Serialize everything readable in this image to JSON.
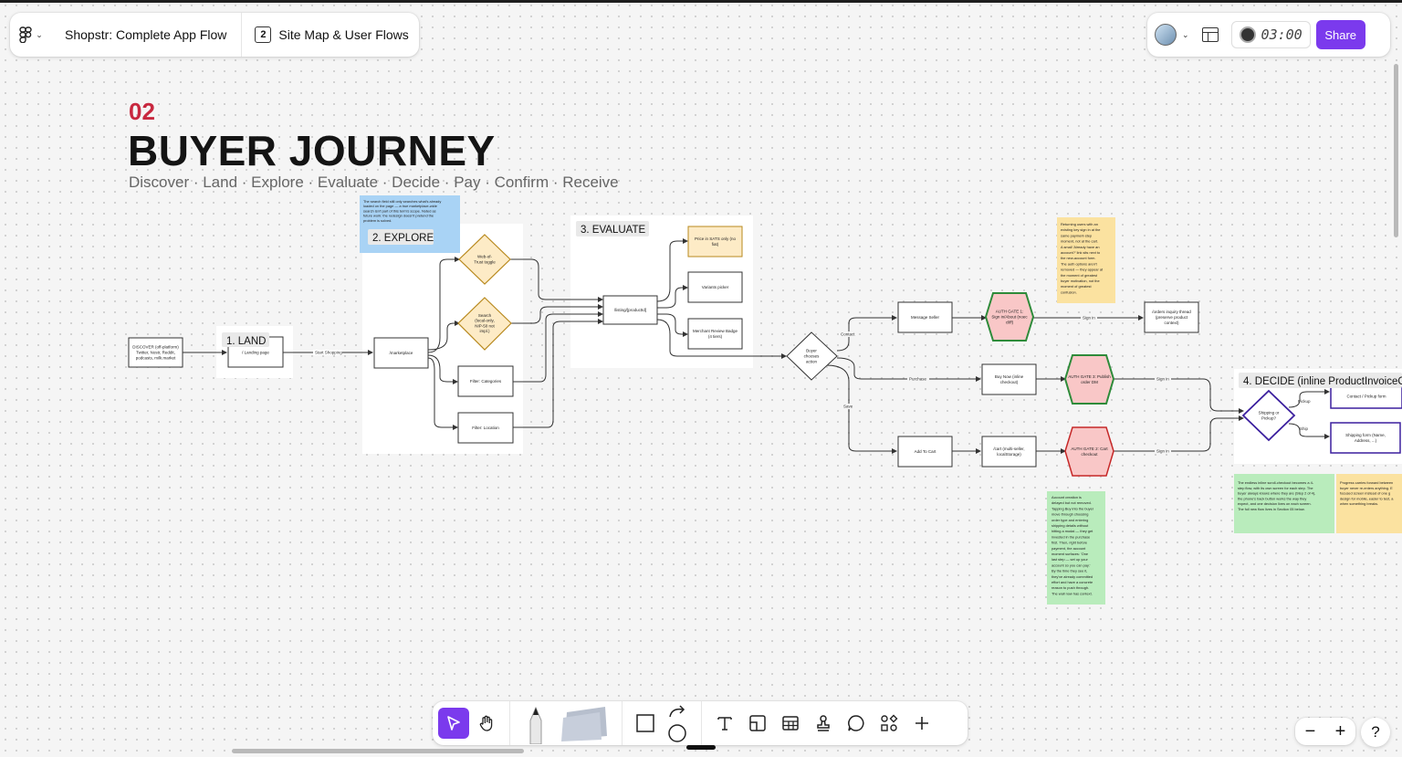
{
  "header": {
    "file_name": "Shopstr: Complete App Flow",
    "page_number": "2",
    "page_name": "Site Map & User Flows",
    "timer": "03:00",
    "share_label": "Share"
  },
  "section": {
    "number": "02",
    "title": "BUYER JOURNEY",
    "subtitle": "Discover · Land · Explore · Evaluate · Decide · Pay · Confirm · Receive"
  },
  "frames": {
    "land": "1. LAND",
    "explore": "2. EXPLORE",
    "evaluate": "3. EVALUATE",
    "decide": "4. DECIDE (inline ProductInvoiceC"
  },
  "nodes": {
    "discover": [
      "DISCOVER (off-platform)",
      "Twitter, Nostr, Reddit,",
      "podcasts, milk.market"
    ],
    "landing": [
      "/ Landing page"
    ],
    "marketplace": [
      "/marketplace"
    ],
    "wot": [
      "Web-of-",
      "Trust toggle"
    ],
    "search": [
      "Search",
      "(local-only,",
      "NIP-50 not",
      "impl.)"
    ],
    "filter_categories": [
      "Filter: Categories"
    ],
    "filter_location": [
      "Filter: Location"
    ],
    "listing": [
      "/listing/[productId]"
    ],
    "price": [
      "Price in SATS only (no",
      "fiat)"
    ],
    "variants": [
      "Variants picker"
    ],
    "merchant": [
      "Merchant Review Badge",
      "(4 tiers)"
    ],
    "buyer_action": [
      "Buyer",
      "chooses",
      "action"
    ],
    "message_seller": [
      "Message Seller"
    ],
    "buy_now": [
      "Buy Now (inline",
      "checkout)"
    ],
    "add_to_cart": [
      "Add To Cart"
    ],
    "cart": [
      "/cart (multi-seller,",
      "localStorage)"
    ],
    "auth1": [
      "AUTH GATE 1:",
      "Sign in/About (noec",
      "cliff)"
    ],
    "auth3": [
      "AUTH GATE 3: Publish",
      "order DM"
    ],
    "auth2": [
      "AUTH GATE 2: Cart",
      "checkout"
    ],
    "orders": [
      "/orders inquiry thread",
      "(preserve product",
      "context)"
    ],
    "shipping": [
      "Shipping or",
      "Pickup?"
    ],
    "contact_pickup": [
      "Contact / Pickup form"
    ],
    "shipping_form": [
      "Shipping form (Name,",
      "Address, ...)"
    ]
  },
  "edge_labels": {
    "start_shopping": "Start Shopping",
    "contact": "Contact",
    "purchase": "Purchase",
    "save": "Save",
    "sign_in": "Sign in",
    "pickup": "Pickup",
    "ship": "Ship"
  },
  "notes": {
    "explore_note": [
      "The search field still only searches what's already",
      "loaded on the page — a true marketplace-wide",
      "search isn't part of this term's scope. Noted as",
      "future work: the redesign doesn't pretend the",
      "problem is solved."
    ],
    "auth_note": [
      "Returning users with an",
      "existing key sign in at the",
      "same payment-step",
      "moment, not at the cart.",
      "A small 'Already have an",
      "account?' link sits next to",
      "the new-account form.",
      "The auth options aren't",
      "removed — they appear at",
      "the moment of greatest",
      "buyer motivation, not the",
      "moment of greatest",
      "confusion."
    ],
    "account_note": [
      "Account creation is",
      "delayed but not removed.",
      "Tapping Buy into the buyer",
      "move through choosing",
      "order type and entering",
      "shipping details without",
      "hitting a modal — they get",
      "invested in the purchase",
      "first. Then, right before",
      "payment, the account",
      "moment surfaces: 'One",
      "last step — set up your",
      "account so you can pay.'",
      "By the time they see it,",
      "they've already committed",
      "effort and have a concrete",
      "reason to push through.",
      "The wall now has context."
    ],
    "checkout_note": [
      "The endless inline scroll-checkout becomes a 4-",
      "step flow, with its own screen for each step. The",
      "buyer always knows where they are (Step 2 of 4),",
      "the phone's back button works the way they",
      "expect, and one decision lives on each screen.",
      "The full new flow lives in Section 05 below."
    ],
    "progress_note": [
      "Progress carries forward between",
      "buyer never re-enters anything. E",
      "focused screen instead of one g",
      "design for mobile, easier to test, a",
      "when something breaks."
    ]
  },
  "colors": {
    "accent": "#7b3aed",
    "section_number": "#c8283f",
    "diamond_fill": "#fdebc6",
    "diamond_stroke": "#b8891e",
    "auth_green_fill": "#f9c7c7",
    "auth_green_stroke": "#2e8b3a",
    "auth_red_stroke": "#c62828",
    "note_blue": "#a9d3f5",
    "note_yellow": "#fbe2a0",
    "note_green": "#b9ecbc",
    "purple_stroke": "#3b1f9e"
  },
  "icons": [
    "figma-logo-icon",
    "page-icon",
    "layout-icon",
    "timer-icon",
    "cursor-icon",
    "hand-icon",
    "pen-icon",
    "sticky-icon",
    "shape-icon",
    "connector-icon",
    "text-icon",
    "frame-icon",
    "table-icon",
    "stamp-icon",
    "comment-icon",
    "widgets-icon",
    "plus-icon",
    "zoom-out-icon",
    "zoom-in-icon",
    "help-icon"
  ]
}
